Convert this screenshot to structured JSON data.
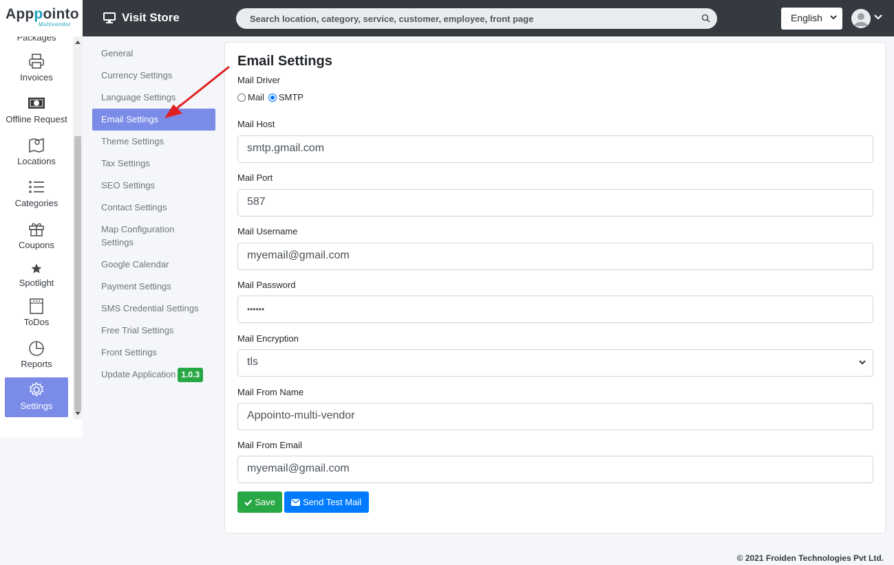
{
  "brand": {
    "name_a": "App",
    "name_b": "p",
    "name_c": "ointo",
    "sub": "Multivendor"
  },
  "sidebar": {
    "items": [
      {
        "label": "Packages",
        "icon": "package-icon"
      },
      {
        "label": "Invoices",
        "icon": "printer-icon"
      },
      {
        "label": "Offline Request",
        "icon": "money-bill-icon"
      },
      {
        "label": "Locations",
        "icon": "map-icon"
      },
      {
        "label": "Categories",
        "icon": "list-icon"
      },
      {
        "label": "Coupons",
        "icon": "gift-icon"
      },
      {
        "label": "Spotlight",
        "icon": "star-icon"
      },
      {
        "label": "ToDos",
        "icon": "notepad-icon"
      },
      {
        "label": "Reports",
        "icon": "pie-chart-icon"
      },
      {
        "label": "Settings",
        "icon": "gear-icon"
      }
    ],
    "active": "Settings"
  },
  "topbar": {
    "visit_store": "Visit Store",
    "search_placeholder": "Search location, category, service, customer, employee, front page",
    "language": "English"
  },
  "submenu": {
    "items": [
      "General",
      "Currency Settings",
      "Language Settings",
      "Email Settings",
      "Theme Settings",
      "Tax Settings",
      "SEO Settings",
      "Contact Settings",
      "Map Configuration Settings",
      "Google Calendar",
      "Payment Settings",
      "SMS Credential Settings",
      "Free Trial Settings",
      "Front Settings",
      "Update Application"
    ],
    "active": "Email Settings",
    "version": "1.0.3"
  },
  "form": {
    "title": "Email Settings",
    "mail_driver_label": "Mail Driver",
    "driver_options": [
      "Mail",
      "SMTP"
    ],
    "driver_selected": "SMTP",
    "mail_host_label": "Mail Host",
    "mail_host": "smtp.gmail.com",
    "mail_port_label": "Mail Port",
    "mail_port": "587",
    "mail_username_label": "Mail Username",
    "mail_username": "myemail@gmail.com",
    "mail_password_label": "Mail Password",
    "mail_password": "••••••",
    "mail_encryption_label": "Mail Encryption",
    "mail_encryption": "tls",
    "mail_from_name_label": "Mail From Name",
    "mail_from_name": "Appointo-multi-vendor",
    "mail_from_email_label": "Mail From Email",
    "mail_from_email": "myemail@gmail.com",
    "save_label": "Save",
    "send_test_label": "Send Test Mail"
  },
  "footer": "© 2021 Froiden Technologies Pvt Ltd.",
  "colors": {
    "topbar": "#343a40",
    "active": "#7b8be8",
    "save": "#28a745",
    "primary": "#007bff"
  }
}
